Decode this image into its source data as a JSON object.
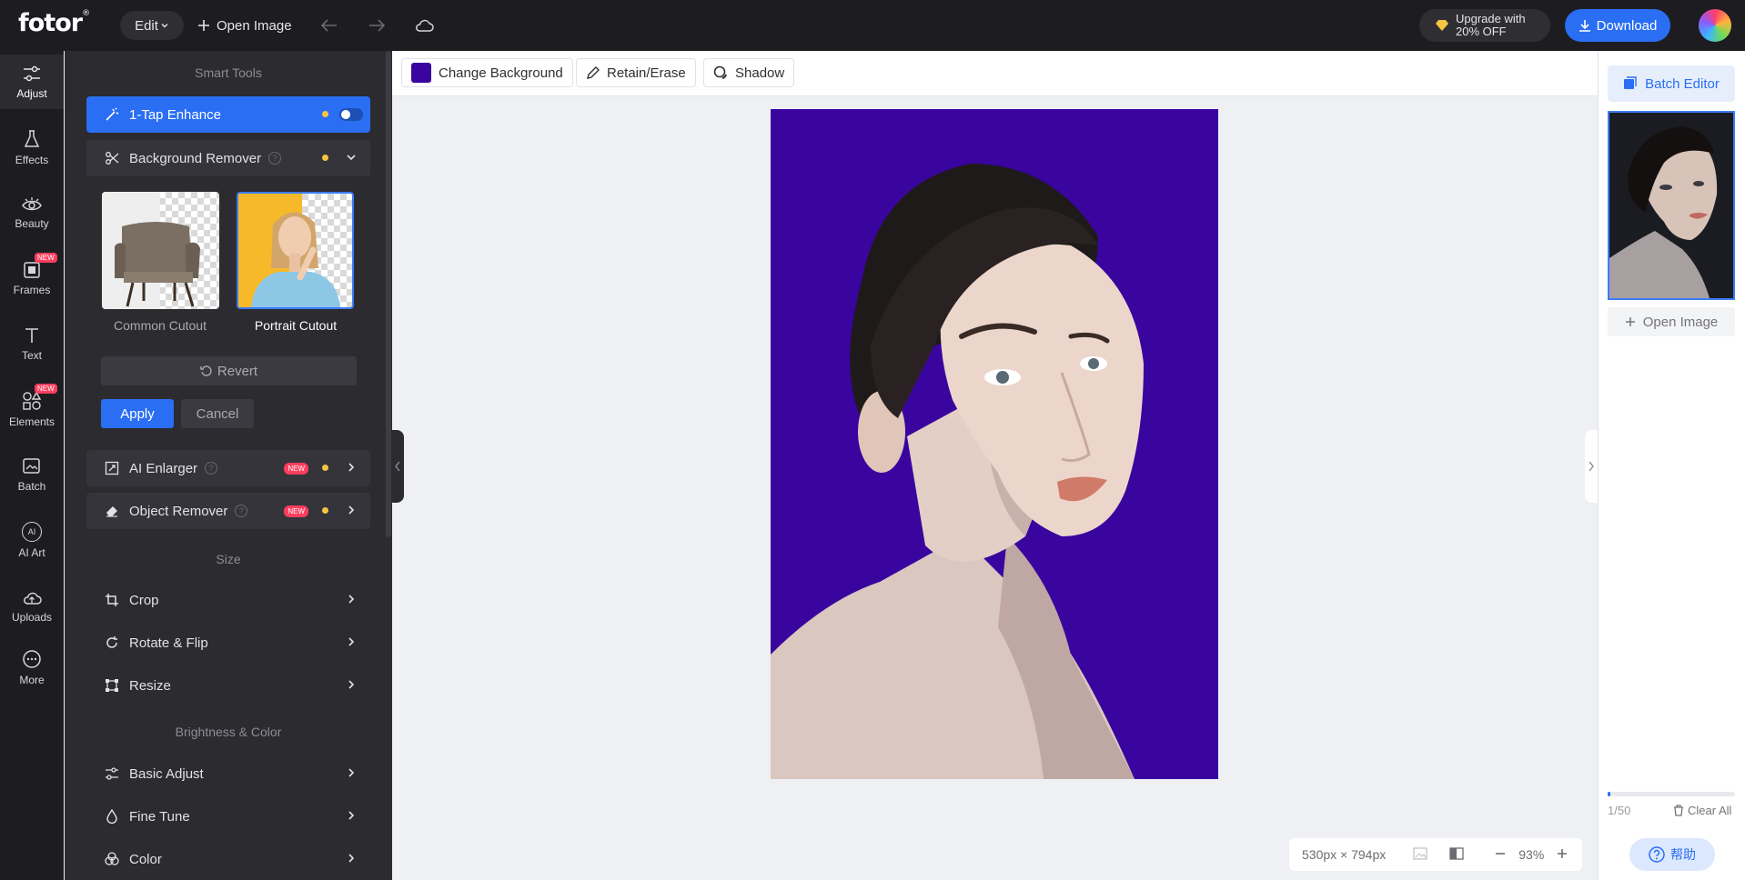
{
  "app": {
    "logo": "fotor",
    "edit_label": "Edit",
    "open_image": "Open Image",
    "upgrade_line1": "Upgrade with",
    "upgrade_line2": "20% OFF",
    "download": "Download"
  },
  "nav": {
    "items": [
      {
        "label": "Adjust",
        "icon": "sliders-icon"
      },
      {
        "label": "Effects",
        "icon": "flask-icon"
      },
      {
        "label": "Beauty",
        "icon": "eye-icon"
      },
      {
        "label": "Frames",
        "icon": "frame-icon",
        "badge": "NEW"
      },
      {
        "label": "Text",
        "icon": "text-icon"
      },
      {
        "label": "Elements",
        "icon": "shapes-icon",
        "badge": "NEW"
      },
      {
        "label": "Batch",
        "icon": "batch-icon"
      },
      {
        "label": "AI Art",
        "icon": "ai-icon",
        "icon_text": "AI"
      },
      {
        "label": "Uploads",
        "icon": "upload-cloud-icon"
      },
      {
        "label": "More",
        "icon": "more-icon"
      }
    ]
  },
  "panel": {
    "smart_tools_title": "Smart Tools",
    "one_tap": "1-Tap Enhance",
    "bg_remover": "Background Remover",
    "bg_remover_help": "?",
    "common_cutout": "Common Cutout",
    "portrait_cutout": "Portrait Cutout",
    "revert": "Revert",
    "apply": "Apply",
    "cancel": "Cancel",
    "ai_enlarger": "AI Enlarger",
    "object_remover": "Object Remover",
    "new_tag": "NEW",
    "size_title": "Size",
    "crop": "Crop",
    "rotate_flip": "Rotate & Flip",
    "resize": "Resize",
    "brightness_title": "Brightness & Color",
    "basic_adjust": "Basic Adjust",
    "fine_tune": "Fine Tune",
    "color": "Color"
  },
  "subtoolbar": {
    "change_background": "Change Background",
    "background_color": "#3a049e",
    "retain_erase": "Retain/Erase",
    "shadow": "Shadow"
  },
  "canvas": {
    "dimensions": "530px × 794px",
    "zoom": "93%"
  },
  "right": {
    "batch_editor": "Batch Editor",
    "open_image": "Open Image",
    "count": "1/50",
    "clear_all": "Clear All",
    "help": "帮助",
    "progress": 0.02
  },
  "colors": {
    "accent": "#2a6ef3",
    "dark_bg": "#1d1d21",
    "panel_bg": "#2b2b30",
    "badge": "#ff3e5e",
    "dot": "#f5c542"
  }
}
